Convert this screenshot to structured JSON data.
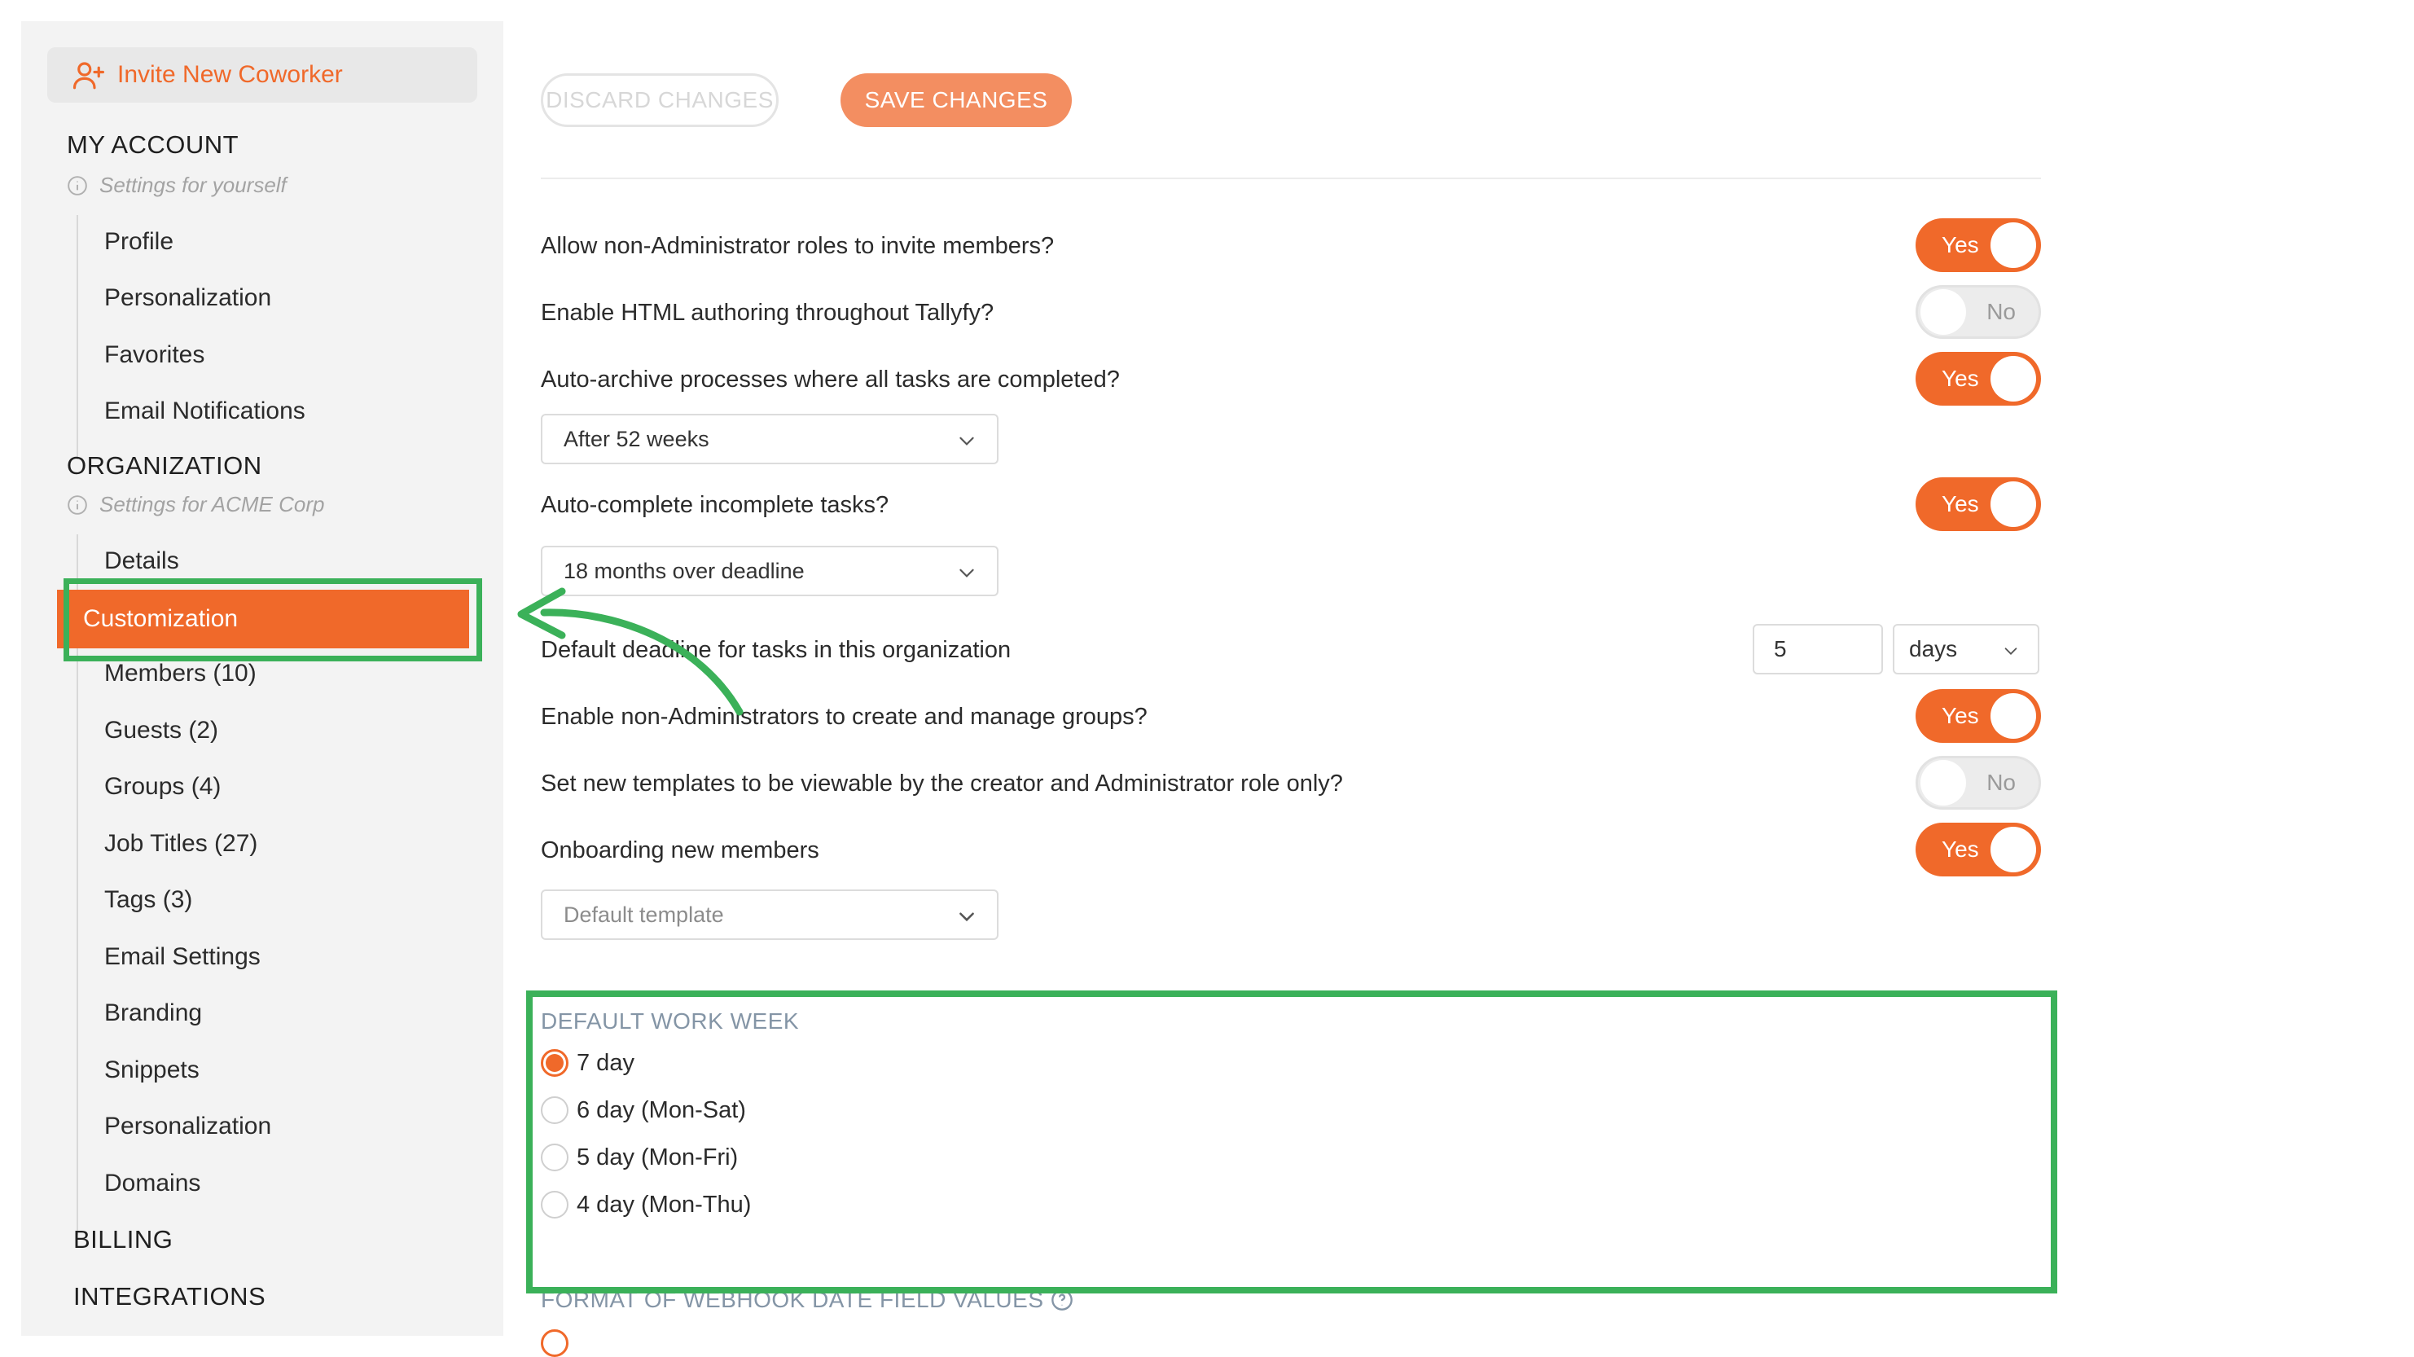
{
  "sidebar": {
    "invite_button": "Invite New Coworker",
    "my_account": {
      "title": "MY ACCOUNT",
      "subtitle": "Settings for yourself",
      "items": [
        "Profile",
        "Personalization",
        "Favorites",
        "Email Notifications"
      ]
    },
    "organization": {
      "title": "ORGANIZATION",
      "subtitle": "Settings for ACME Corp",
      "items": [
        "Details",
        "Customization",
        "Members (10)",
        "Guests (2)",
        "Groups (4)",
        "Job Titles (27)",
        "Tags (3)",
        "Email Settings",
        "Branding",
        "Snippets",
        "Personalization",
        "Domains"
      ],
      "active_item": "Customization"
    },
    "billing": "BILLING",
    "integrations": "INTEGRATIONS"
  },
  "toolbar": {
    "discard_label": "DISCARD CHANGES",
    "save_label": "SAVE CHANGES"
  },
  "settings": {
    "allow_invite": {
      "question": "Allow non-Administrator roles to invite members?",
      "value": "Yes"
    },
    "enable_html": {
      "question": "Enable HTML authoring throughout Tallyfy?",
      "value": "No"
    },
    "auto_archive": {
      "question": "Auto-archive processes where all tasks are completed?",
      "value": "Yes",
      "option": "After 52 weeks"
    },
    "auto_complete": {
      "question": "Auto-complete incomplete tasks?",
      "value": "Yes",
      "option": "18 months over deadline"
    },
    "default_deadline": {
      "question": "Default deadline for tasks in this organization",
      "amount": "5",
      "unit": "days"
    },
    "manage_groups": {
      "question": "Enable non-Administrators to create and manage groups?",
      "value": "Yes"
    },
    "templates_viewable": {
      "question": "Set new templates to be viewable by the creator and Administrator role only?",
      "value": "No"
    },
    "onboarding": {
      "question": "Onboarding new members",
      "value": "Yes",
      "placeholder": "Default template"
    }
  },
  "work_week": {
    "title": "DEFAULT WORK WEEK",
    "options": [
      "7 day",
      "6 day (Mon-Sat)",
      "5 day (Mon-Fri)",
      "4 day (Mon-Thu)"
    ],
    "selected": "7 day"
  },
  "webhook": {
    "title": "FORMAT OF WEBHOOK DATE FIELD VALUES"
  },
  "colors": {
    "accent": "#f0692a",
    "highlight": "#3bb159",
    "sidebar_bg": "#f3f3f3"
  }
}
